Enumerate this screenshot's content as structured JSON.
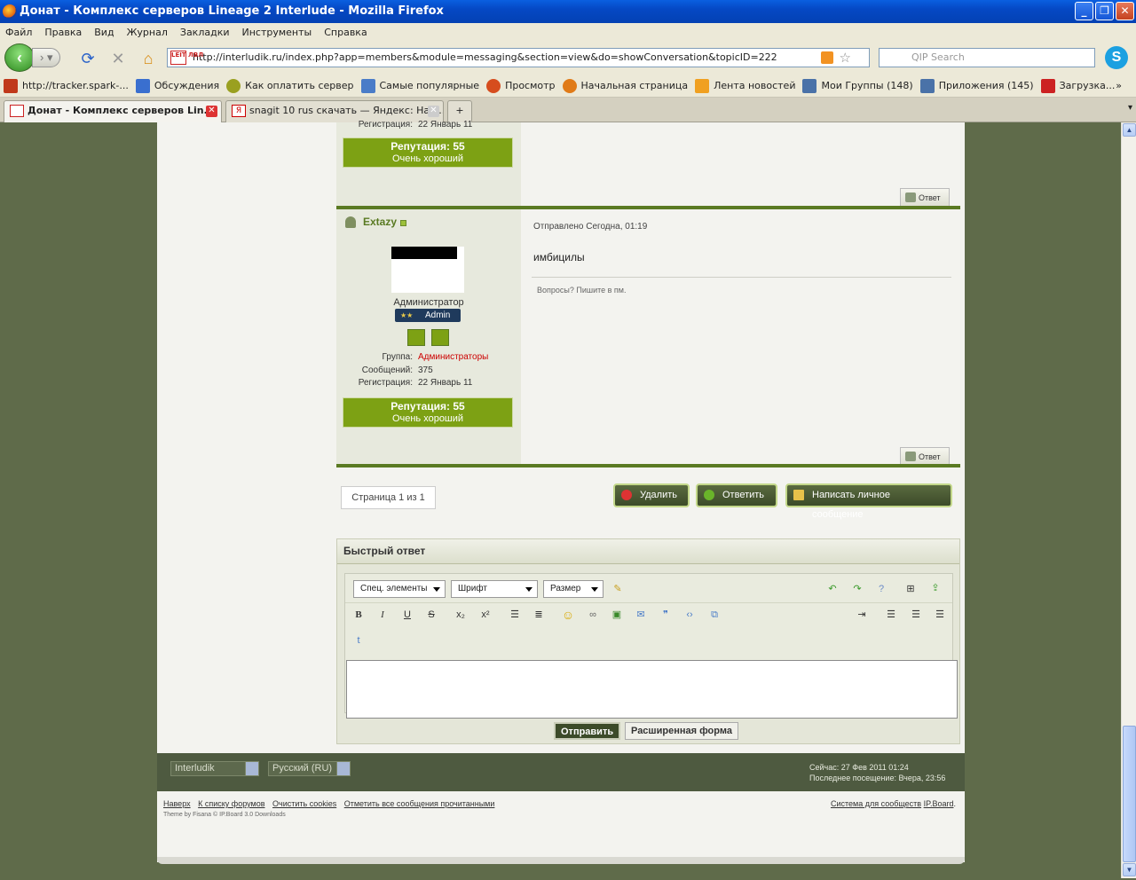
{
  "window": {
    "title": "Донат - Комплекс серверов Lineage 2 Interlude - Mozilla Firefox",
    "min": "_",
    "max": "❐",
    "close": "✕"
  },
  "menu": [
    "Файл",
    "Правка",
    "Вид",
    "Журнал",
    "Закладки",
    "Инструменты",
    "Справка"
  ],
  "nav": {
    "url": "http://interludik.ru/index.php?app=members&module=messaging&section=view&do=showConversation&topicID=222",
    "search_placeholder": "QIP Search",
    "site_icon_text": "LEIT ЛВЛ"
  },
  "bookmarks": [
    {
      "label": "http://tracker.spark-...",
      "color": "#c0391b"
    },
    {
      "label": "Обсуждения",
      "color": "#3a6fcf"
    },
    {
      "label": "Как оплатить сервер",
      "color": "#9aa020"
    },
    {
      "label": "Самые популярные",
      "color": "#4a7cc8"
    },
    {
      "label": "Просмотр",
      "color": "#d64d1e"
    },
    {
      "label": "Начальная страница",
      "color": "#e07b18"
    },
    {
      "label": "Лента новостей",
      "color": "#f0a020"
    },
    {
      "label": "Мои Группы (148)",
      "color": "#4a72a8"
    },
    {
      "label": "Приложения (145)",
      "color": "#4a72a8"
    },
    {
      "label": "Загрузка...",
      "color": "#c22"
    }
  ],
  "tabs": [
    {
      "label": "Донат - Комплекс серверов Lin..."
    },
    {
      "label": "snagit 10 rus скачать — Яндекс: Наш..."
    }
  ],
  "post_prev": {
    "reg_label": "Регистрация:",
    "reg_value": "22 Январь 11",
    "rep_value": "Репутация: 55",
    "rep_level": "Очень хороший",
    "reply": "Ответ"
  },
  "post": {
    "username": "Extazy",
    "sent": "Отправлено Сегодна, 01:19",
    "body": "имбицилы",
    "signature": "Вопросы? Пишите в пм.",
    "role": "Администратор",
    "badge": "Admin",
    "meta": [
      {
        "k": "Группа:",
        "v": "Администраторы"
      },
      {
        "k": "Сообщений:",
        "v": "375"
      },
      {
        "k": "Регистрация:",
        "v": "22 Январь 11"
      }
    ],
    "rep_value": "Репутация: 55",
    "rep_level": "Очень хороший",
    "reply": "Ответ"
  },
  "pager": "Страница 1 из 1",
  "actions": {
    "delete": "Удалить",
    "reply": "Ответить",
    "pm": "Написать личное сообщение"
  },
  "quick_reply": {
    "title": "Быстрый ответ",
    "special": "Спец. элементы",
    "font": "Шрифт",
    "size": "Размер",
    "send": "Отправить",
    "advanced": "Расширенная форма"
  },
  "footer": {
    "skin": "Interludik",
    "lang": "Русский (RU)",
    "now": "Сейчас: 27 Фев 2011 01:24",
    "last_visit": "Последнее посещение: Вчера, 23:56",
    "links": [
      "Наверх",
      "К списку форумов",
      "Очистить cookies",
      "Отметить все сообщения прочитанными"
    ],
    "theme": "Theme by Fisana © IP.Board 3.0 Downloads",
    "powered_a": "Система для сообществ",
    "powered_b": "IP.Board",
    "period": "."
  }
}
